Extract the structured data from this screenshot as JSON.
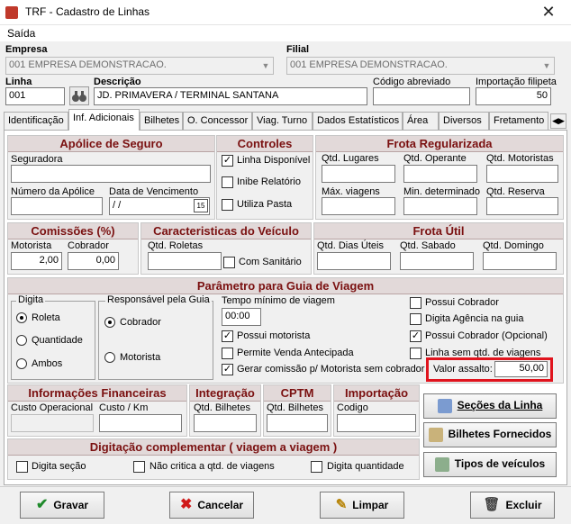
{
  "window": {
    "title": "TRF - Cadastro de Linhas",
    "close": "✕"
  },
  "menu": {
    "saida": "Saída"
  },
  "top": {
    "empresa_label": "Empresa",
    "empresa_value": "001 EMPRESA DEMONSTRACAO.",
    "filial_label": "Filial",
    "filial_value": "001 EMPRESA DEMONSTRACAO.",
    "linha_label": "Linha",
    "linha_value": "001",
    "descricao_label": "Descrição",
    "descricao_value": "JD. PRIMAVERA / TERMINAL SANTANA",
    "codigo_label": "Código abreviado",
    "codigo_value": "",
    "importacao_label": "Importação filipeta",
    "importacao_value": "50"
  },
  "tabs": [
    "Identificação",
    "Inf. Adicionais",
    "Bilhetes",
    "O. Concessor",
    "Viag. Turno",
    "Dados Estatísticos",
    "Área",
    "Diversos",
    "Fretamento"
  ],
  "apolice": {
    "title": "Apólice de Seguro",
    "seguradora": "Seguradora",
    "numero": "Número da Apólice",
    "vencimento": "Data de Vencimento",
    "vencimento_value": " /  /",
    "cal": "15"
  },
  "controles": {
    "title": "Controles",
    "linha_disponivel": "Linha Disponível",
    "inibe": "Inibe Relatório",
    "utiliza_pasta": "Utiliza Pasta"
  },
  "frota_reg": {
    "title": "Frota Regularizada",
    "qtd_lugares": "Qtd. Lugares",
    "qtd_operante": "Qtd. Operante",
    "qtd_motoristas": "Qtd. Motoristas",
    "max_viagens": "Máx. viagens",
    "min_determinado": "Min. determinado",
    "qtd_reserva": "Qtd. Reserva"
  },
  "comissoes": {
    "title": "Comissões (%)",
    "motorista": "Motorista",
    "motorista_value": "2,00",
    "cobrador": "Cobrador",
    "cobrador_value": "0,00"
  },
  "caracteristicas": {
    "title": "Caracteristicas do Veículo",
    "qtd_roletas": "Qtd. Roletas",
    "com_sanitario": "Com Sanitário"
  },
  "frota_util": {
    "title": "Frota Útil",
    "dias_uteis": "Qtd. Dias Úteis",
    "sabado": "Qtd. Sabado",
    "domingo": "Qtd. Domingo"
  },
  "guia": {
    "title": "Parâmetro para Guia de Viagem",
    "digita": "Digita",
    "roleta": "Roleta",
    "quantidade": "Quantidade",
    "ambos": "Ambos",
    "responsavel": "Responsável pela Guia",
    "cobrador": "Cobrador",
    "motorista": "Motorista",
    "tempo_minimo": "Tempo mínimo de viagem",
    "tempo_value": "00:00",
    "possui_motorista": "Possui motorista",
    "permite_venda": "Permite Venda Antecipada",
    "gerar_comissao": "Gerar comissão p/ Motorista sem cobrador",
    "possui_cobrador": "Possui Cobrador",
    "digita_agencia": "Digita Agência na guia",
    "possui_cobrador_opc": "Possui Cobrador (Opcional)",
    "linha_sem_qtd": "Linha sem  qtd. de viagens",
    "valor_assalto": "Valor assalto:",
    "valor_assalto_value": "50,00"
  },
  "financeiras": {
    "title": "Informações Financeiras",
    "custo_operacional": "Custo Operacional",
    "custo_km": "Custo / Km"
  },
  "integracao": {
    "title": "Integração",
    "qtd_bilhetes": "Qtd. Bilhetes"
  },
  "cptm": {
    "title": "CPTM",
    "qtd_bilhetes": "Qtd. Bilhetes"
  },
  "importacao": {
    "title": "Importação",
    "codigo": "Codigo"
  },
  "side_buttons": {
    "secoes": "Seções da Linha",
    "bilhetes": "Bilhetes Fornecidos",
    "tipos": "Tipos de veículos"
  },
  "digitacao": {
    "title": "Digitação complementar ( viagem a viagem )",
    "digita_secao": "Digita seção",
    "nao_critica": "Não critica a qtd. de  viagens",
    "digita_quantidade": "Digita quantidade"
  },
  "actions": {
    "gravar": "Gravar",
    "cancelar": "Cancelar",
    "limpar": "Limpar",
    "excluir": "Excluir"
  },
  "colors": {
    "header_text": "#7a1010",
    "highlight": "#e0141e"
  }
}
